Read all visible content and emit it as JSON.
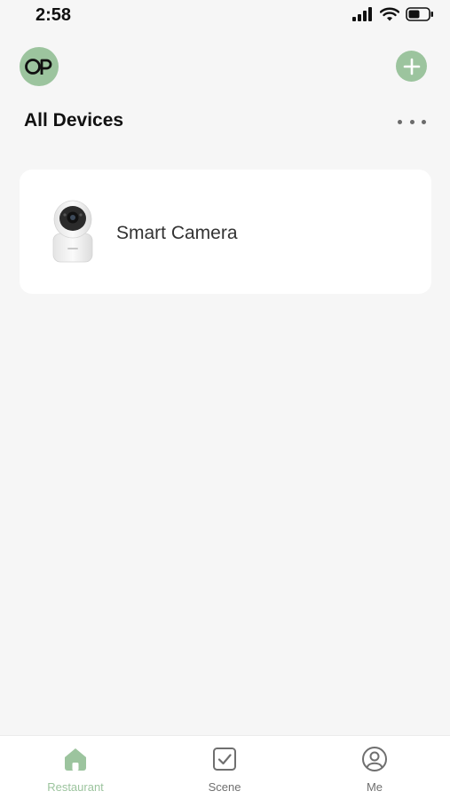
{
  "status_bar": {
    "time": "2:58",
    "icons": [
      "signal-icon",
      "wifi-icon",
      "battery-icon"
    ]
  },
  "header": {
    "avatar_initials": "OP",
    "add_button_icon": "plus-icon",
    "title": "All Devices",
    "more_button_icon": "more-dots-icon"
  },
  "devices": [
    {
      "name": "Smart Camera",
      "icon": "camera-device-image"
    }
  ],
  "tab_bar": {
    "tabs": [
      {
        "label": "Restaurant",
        "icon": "home-icon",
        "active": true
      },
      {
        "label": "Scene",
        "icon": "scene-checkbox-icon",
        "active": false
      },
      {
        "label": "Me",
        "icon": "profile-icon",
        "active": false
      }
    ]
  },
  "colors": {
    "accent": "#9cc49e",
    "background": "#f6f6f6",
    "card": "#ffffff",
    "text_primary": "#111111",
    "tab_inactive": "#6f6f6f"
  }
}
